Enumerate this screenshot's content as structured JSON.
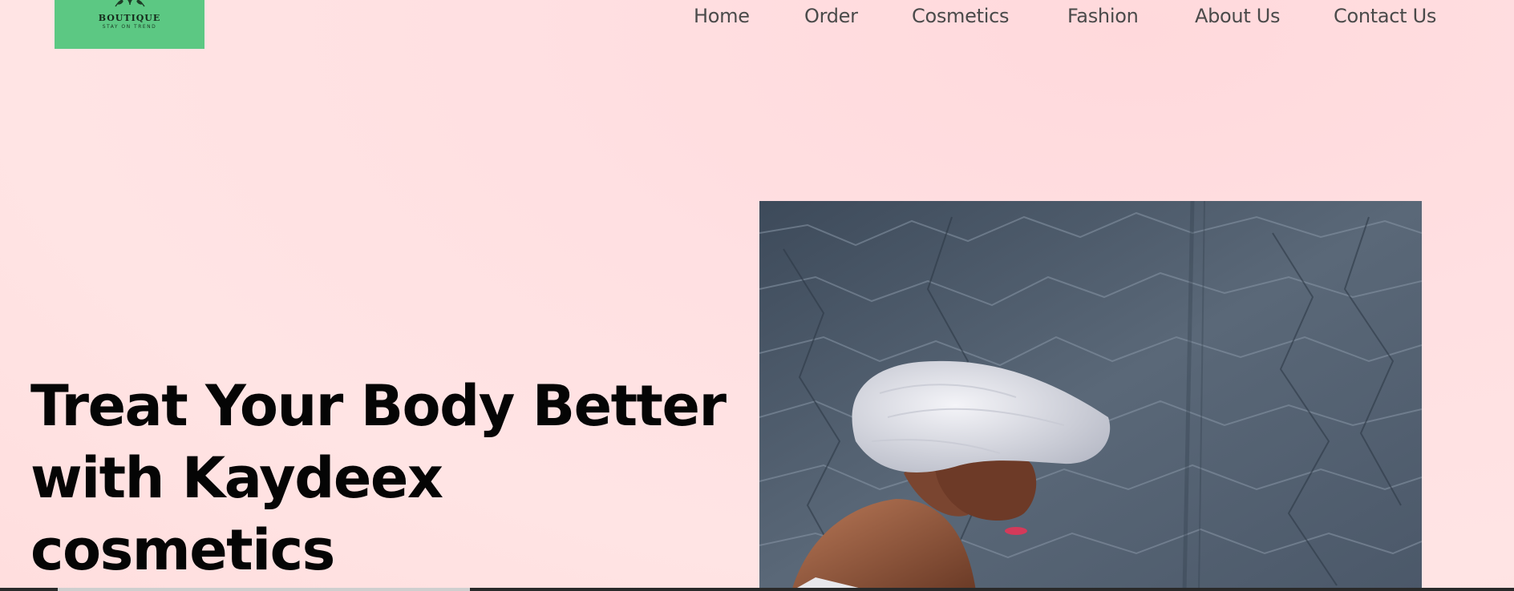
{
  "logo": {
    "name": "BOUTIQUE",
    "tagline": "STAY ON TREND",
    "background": "#5cc883",
    "icon": "leaf-icon"
  },
  "nav": {
    "items": [
      {
        "label": "Home"
      },
      {
        "label": "Order"
      },
      {
        "label": "Cosmetics"
      },
      {
        "label": "Fashion"
      },
      {
        "label": "About Us"
      },
      {
        "label": "Contact Us"
      }
    ]
  },
  "hero": {
    "title_line1": "Treat Your Body Better",
    "title_line2": "with Kaydeex",
    "title_line3": "cosmetics",
    "image": "woman-in-towel-photo"
  },
  "colors": {
    "page_background": "#ffe0e2",
    "nav_text": "#4a4a4a",
    "title_text": "#050505"
  }
}
